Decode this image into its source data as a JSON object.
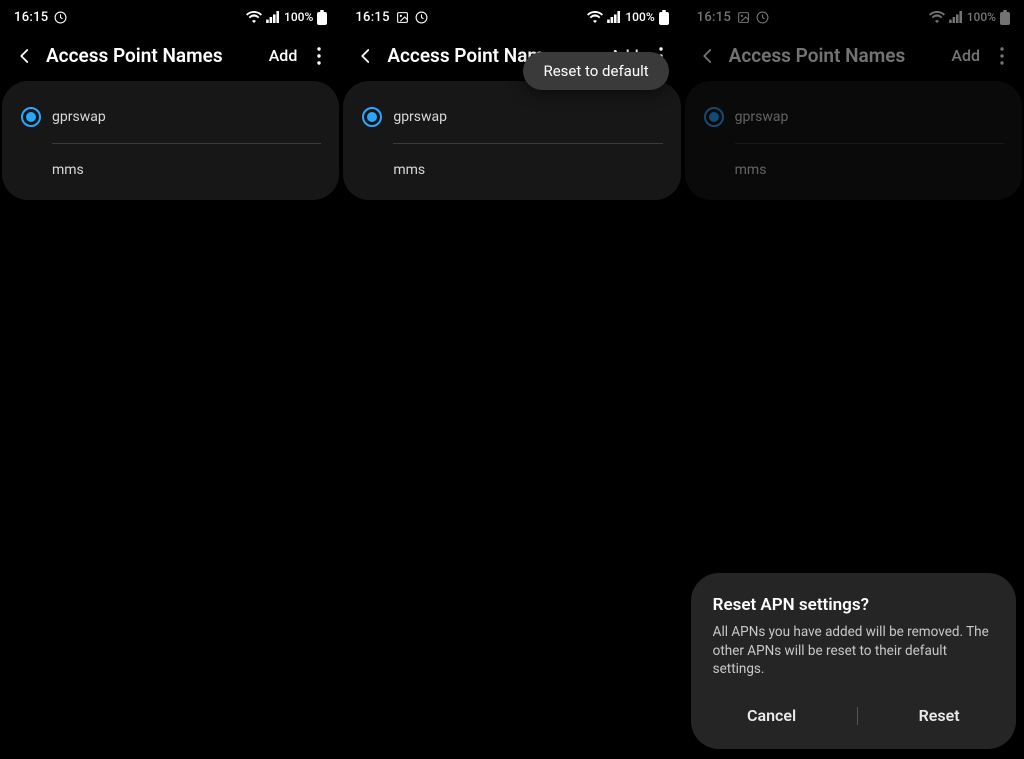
{
  "phones": [
    {
      "status": {
        "time": "16:15",
        "battery_pct": "100%",
        "has_image_icon": false
      },
      "header": {
        "title": "Access Point Names",
        "add": "Add"
      },
      "apns": [
        {
          "name": "gprswap",
          "selected": true
        },
        {
          "name": "mms",
          "selected": false
        }
      ],
      "menu_open": false,
      "dialog": null
    },
    {
      "status": {
        "time": "16:15",
        "battery_pct": "100%",
        "has_image_icon": true
      },
      "header": {
        "title": "Access Point Nam",
        "add": "Add"
      },
      "apns": [
        {
          "name": "gprswap",
          "selected": true
        },
        {
          "name": "mms",
          "selected": false
        }
      ],
      "menu_open": true,
      "menu_label": "Reset to default",
      "dialog": null
    },
    {
      "status": {
        "time": "16:15",
        "battery_pct": "100%",
        "has_image_icon": true
      },
      "header": {
        "title": "Access Point Names",
        "add": "Add"
      },
      "apns": [
        {
          "name": "gprswap",
          "selected": true
        },
        {
          "name": "mms",
          "selected": false
        }
      ],
      "menu_open": false,
      "dialog": {
        "title": "Reset APN settings?",
        "body": "All APNs you have added will be removed. The other APNs will be reset to their default settings.",
        "cancel": "Cancel",
        "confirm": "Reset"
      }
    }
  ]
}
